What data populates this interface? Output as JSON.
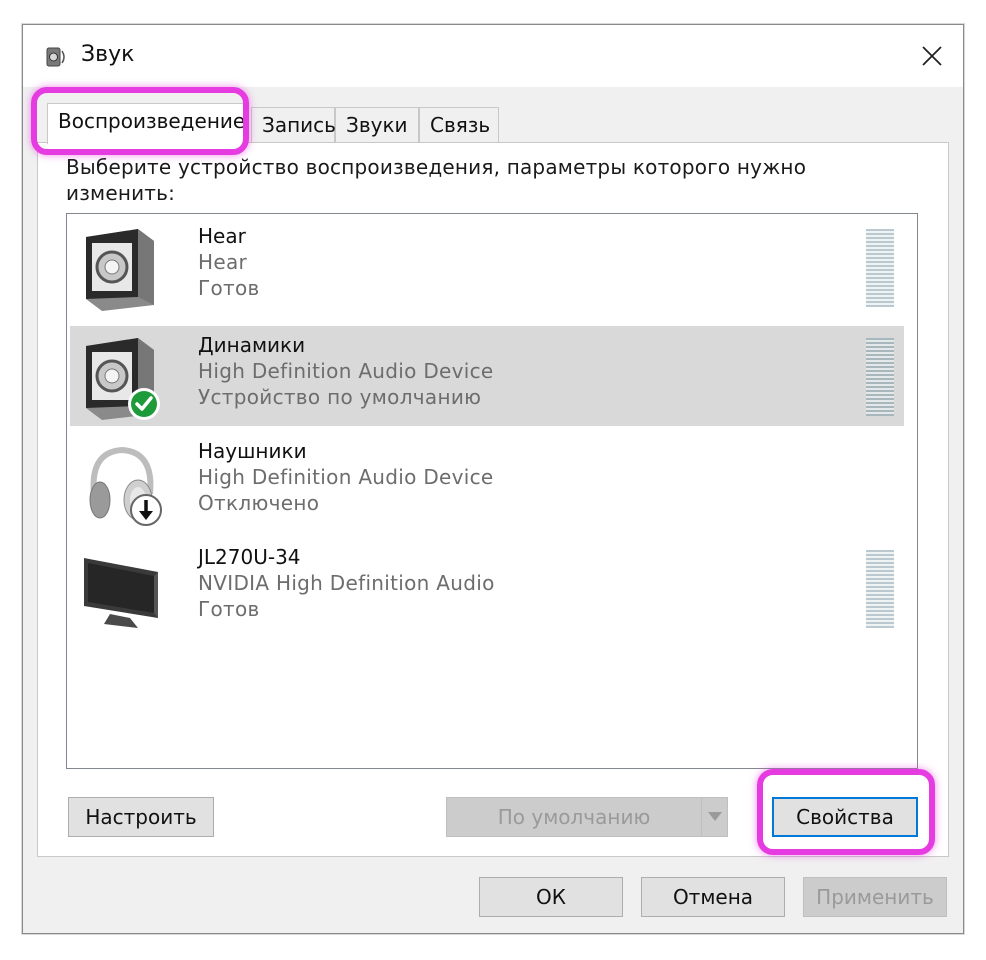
{
  "window": {
    "title": "Звук",
    "icon": "speaker-icon",
    "close": "close-icon"
  },
  "tabs": [
    {
      "label": "Воспроизведение",
      "active": true
    },
    {
      "label": "Запись",
      "active": false
    },
    {
      "label": "Звуки",
      "active": false
    },
    {
      "label": "Связь",
      "active": false
    }
  ],
  "panel": {
    "instruction": "Выберите устройство воспроизведения, параметры которого нужно изменить:"
  },
  "devices": [
    {
      "name": "Hear",
      "description": "Hear",
      "status": "Готов",
      "icon": "speaker-icon",
      "badge": "",
      "selected": false,
      "meter": true
    },
    {
      "name": "Динамики",
      "description": "High Definition Audio Device",
      "status": "Устройство по умолчанию",
      "icon": "speaker-icon",
      "badge": "default-check-icon",
      "selected": true,
      "meter": true
    },
    {
      "name": "Наушники",
      "description": "High Definition Audio Device",
      "status": "Отключено",
      "icon": "headphones-icon",
      "badge": "disabled-arrow-icon",
      "selected": false,
      "meter": false
    },
    {
      "name": "JL270U-34",
      "description": "NVIDIA High Definition Audio",
      "status": "Готов",
      "icon": "monitor-icon",
      "badge": "",
      "selected": false,
      "meter": true
    }
  ],
  "buttons": {
    "configure": "Настроить",
    "set_default": "По умолчанию",
    "properties": "Свойства",
    "ok": "ОК",
    "cancel": "Отмена",
    "apply": "Применить"
  },
  "colors": {
    "highlight": "#e53be0",
    "selection": "#d9d9d9",
    "accent": "#0078d7",
    "check_green": "#1e9a3a"
  }
}
